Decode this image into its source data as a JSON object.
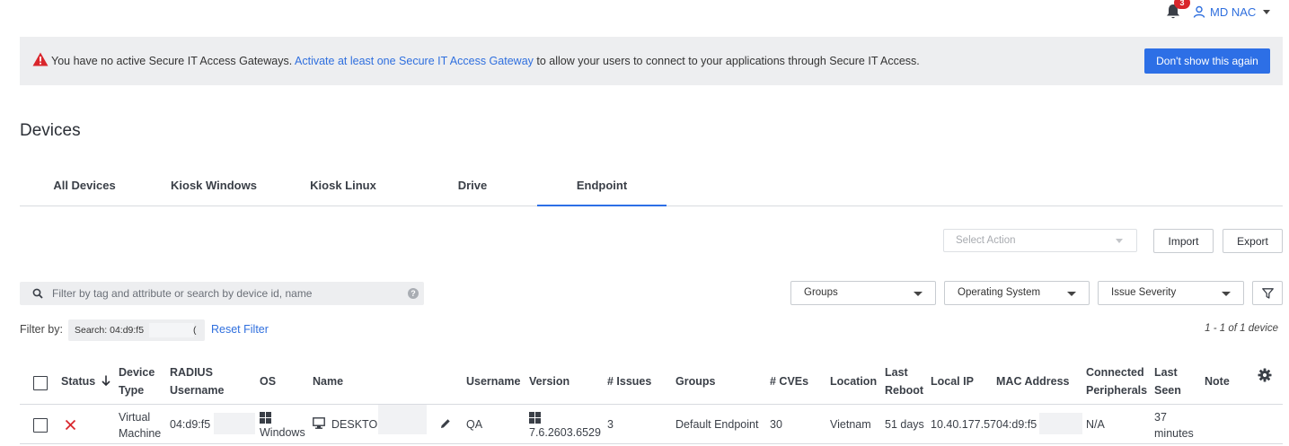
{
  "header": {
    "notifications_count": "3",
    "user_name": "MD NAC"
  },
  "banner": {
    "text_before": "You have no active Secure IT Access Gateways.",
    "link_text": "Activate at least one Secure IT Access Gateway",
    "text_after": "to allow your users to connect to your applications through Secure IT Access.",
    "dismiss_label": "Don't show this again"
  },
  "page": {
    "title": "Devices"
  },
  "tabs": [
    {
      "label": "All Devices"
    },
    {
      "label": "Kiosk Windows"
    },
    {
      "label": "Kiosk Linux"
    },
    {
      "label": "Drive"
    },
    {
      "label": "Endpoint",
      "active": true
    }
  ],
  "actions": {
    "select_action_placeholder": "Select Action",
    "import_label": "Import",
    "export_label": "Export"
  },
  "search": {
    "placeholder": "Filter by tag and attribute or search by device id, name",
    "help": "?"
  },
  "filters": {
    "groups_label": "Groups",
    "os_label": "Operating System",
    "severity_label": "Issue Severity"
  },
  "filter_by": {
    "label": "Filter by:",
    "chip_text": "Search: 04:d9:f5",
    "chip_tail": "(",
    "reset_label": "Reset Filter",
    "result_count": "1 - 1 of 1 device"
  },
  "table": {
    "columns": {
      "status": "Status",
      "device_type_1": "Device",
      "device_type_2": "Type",
      "radius_1": "RADIUS",
      "radius_2": "Username",
      "os": "OS",
      "name": "Name",
      "username": "Username",
      "version": "Version",
      "issues": "# Issues",
      "groups": "Groups",
      "cves": "# CVEs",
      "location": "Location",
      "last_reboot_1": "Last",
      "last_reboot_2": "Reboot",
      "local_ip": "Local IP",
      "mac": "MAC Address",
      "peripherals_1": "Connected",
      "peripherals_2": "Peripherals",
      "last_seen_1": "Last",
      "last_seen_2": "Seen",
      "note": "Note"
    },
    "rows": [
      {
        "device_type_1": "Virtual",
        "device_type_2": "Machine",
        "radius": "04:d9:f5",
        "os": "Windows",
        "name": "DESKTOP",
        "username": "QA",
        "version": "7.6.2603.6529",
        "issues": "3",
        "groups": "Default Endpoint",
        "cves": "30",
        "location": "Vietnam",
        "last_reboot": "51 days",
        "local_ip": "10.40.177.57",
        "mac": "04:d9:f5",
        "peripherals": "N/A",
        "last_seen_1": "37",
        "last_seen_2": "minutes"
      }
    ]
  },
  "colors": {
    "accent": "#2d6fe6",
    "link": "#2f6fde",
    "error": "#d9262c",
    "banner_bg": "#edeef0"
  }
}
